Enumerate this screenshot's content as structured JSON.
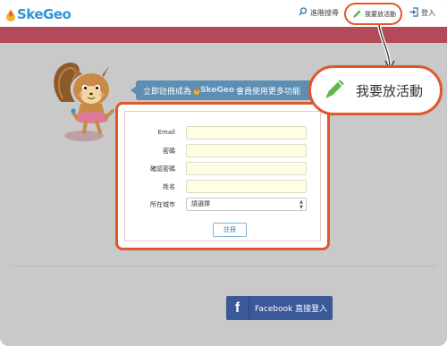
{
  "header": {
    "logo_text": "SkeGeo",
    "search_label": "進階搜尋",
    "create_event_label": "我要放活動",
    "login_label": "登入"
  },
  "promo": {
    "text_before": "立即註冊成為",
    "brand": "SkeGeo",
    "text_after": "會員使用更多功能"
  },
  "form": {
    "fields": [
      {
        "label": "Email"
      },
      {
        "label": "密碼"
      },
      {
        "label": "確認密碼"
      },
      {
        "label": "姓名"
      }
    ],
    "city_label": "所在城市",
    "city_selected": "請選擇",
    "submit_label": "註冊"
  },
  "facebook": {
    "icon_glyph": "f",
    "label": "Facebook 直接登入"
  },
  "callout": {
    "label": "我要放活動"
  },
  "colors": {
    "accent": "#e0582a",
    "brand_blue": "#2f95d4",
    "header_bar": "#b44a58",
    "facebook": "#3b5998"
  },
  "icons": {
    "search": "search-icon",
    "pencil": "pencil-icon",
    "login": "login-icon"
  }
}
